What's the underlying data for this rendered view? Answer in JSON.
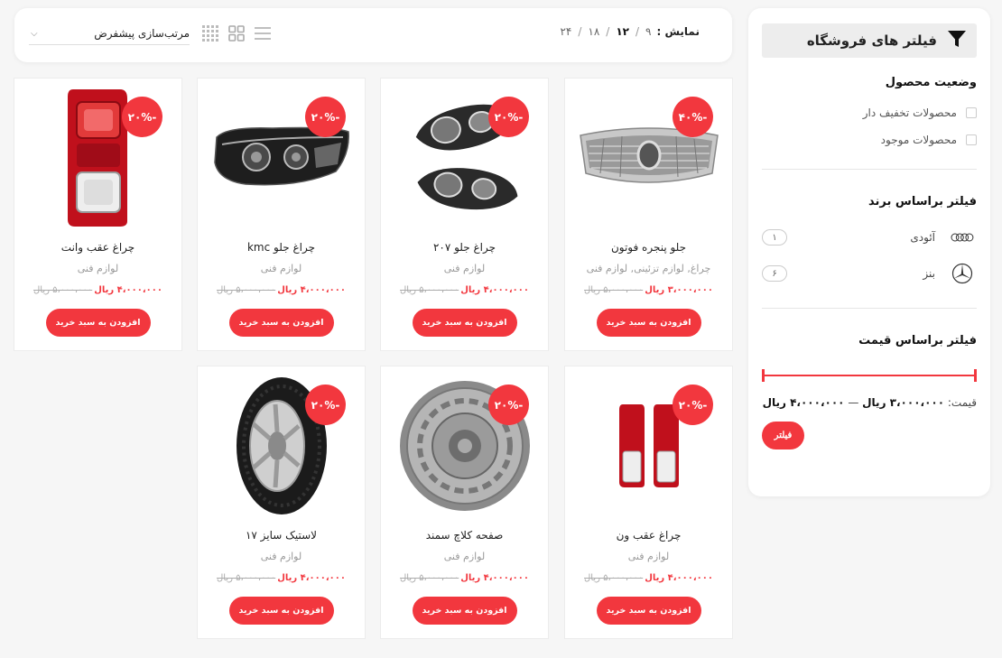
{
  "colors": {
    "accent": "#f2373e",
    "background": "#f6f6f6"
  },
  "sidebar": {
    "title": "فیلتر های فروشگاه",
    "title_icon": "filter-icon",
    "status": {
      "title": "وضعیت محصول",
      "options": [
        {
          "label": "محصولات تخفیف دار",
          "checked": false
        },
        {
          "label": "محصولات موجود",
          "checked": false
        }
      ]
    },
    "brands": {
      "title": "فیلتر براساس برند",
      "items": [
        {
          "name": "آئودی",
          "count": "۱",
          "icon": "audi-logo-icon"
        },
        {
          "name": "بنز",
          "count": "۶",
          "icon": "mercedes-logo-icon"
        }
      ]
    },
    "price": {
      "title": "فیلتر براساس قیمت",
      "label": "قیمت:",
      "min": "۳،۰۰۰،۰۰۰ ریال",
      "dash": "—",
      "max": "۴،۰۰۰،۰۰۰ ریال",
      "min_fraction": 0,
      "max_fraction": 1,
      "button": "فیلتر"
    }
  },
  "toolbar": {
    "show_label": "نمایش :",
    "per_page": [
      {
        "value": "۹",
        "active": false
      },
      {
        "value": "۱۲",
        "active": true
      },
      {
        "value": "۱۸",
        "active": false
      },
      {
        "value": "۲۴",
        "active": false
      }
    ],
    "sep": "/",
    "view_icons": [
      "list-view-icon",
      "grid-2-icon",
      "grid-4-icon"
    ],
    "sort_selected": "مرتب‌سازی پیشفرض",
    "sort_icon": "chevron-down-icon"
  },
  "products": [
    {
      "name": "جلو پنجره فوتون",
      "category": "چراغ, لوازم تزئینی, لوازم فنی",
      "old_price": "۵،۰۰۰،۰۰۰ ریال",
      "new_price": "۳،۰۰۰،۰۰۰ ریال",
      "badge": "-۴۰%",
      "image": "grille-image",
      "button": "افزودن به سبد خرید"
    },
    {
      "name": "چراغ جلو ۲۰۷",
      "category": "لوازم فنی",
      "old_price": "۵،۰۰۰،۰۰۰ ریال",
      "new_price": "۴،۰۰۰،۰۰۰ ریال",
      "badge": "-۲۰%",
      "image": "headlight-pair-image",
      "button": "افزودن به سبد خرید"
    },
    {
      "name": "چراغ جلو kmc",
      "category": "لوازم فنی",
      "old_price": "۵،۰۰۰،۰۰۰ ریال",
      "new_price": "۴،۰۰۰،۰۰۰ ریال",
      "badge": "-۲۰%",
      "image": "headlight-image",
      "button": "افزودن به سبد خرید"
    },
    {
      "name": "چراغ عقب وانت",
      "category": "لوازم فنی",
      "old_price": "۵،۰۰۰،۰۰۰ ریال",
      "new_price": "۴،۰۰۰،۰۰۰ ریال",
      "badge": "-۲۰%",
      "image": "taillight-image",
      "button": "افزودن به سبد خرید"
    },
    {
      "name": "چراغ عقب ون",
      "category": "لوازم فنی",
      "old_price": "۵،۰۰۰،۰۰۰ ریال",
      "new_price": "۴،۰۰۰،۰۰۰ ریال",
      "badge": "-۲۰%",
      "image": "taillight-pair-image",
      "button": "افزودن به سبد خرید"
    },
    {
      "name": "صفحه کلاچ سمند",
      "category": "لوازم فنی",
      "old_price": "۵،۰۰۰،۰۰۰ ریال",
      "new_price": "۴،۰۰۰،۰۰۰ ریال",
      "badge": "-۲۰%",
      "image": "clutch-plate-image",
      "button": "افزودن به سبد خرید"
    },
    {
      "name": "لاستیک سایز ۱۷",
      "category": "لوازم فنی",
      "old_price": "۵،۰۰۰،۰۰۰ ریال",
      "new_price": "۴،۰۰۰،۰۰۰ ریال",
      "badge": "-۲۰%",
      "image": "tire-image",
      "button": "افزودن به سبد خرید"
    }
  ]
}
